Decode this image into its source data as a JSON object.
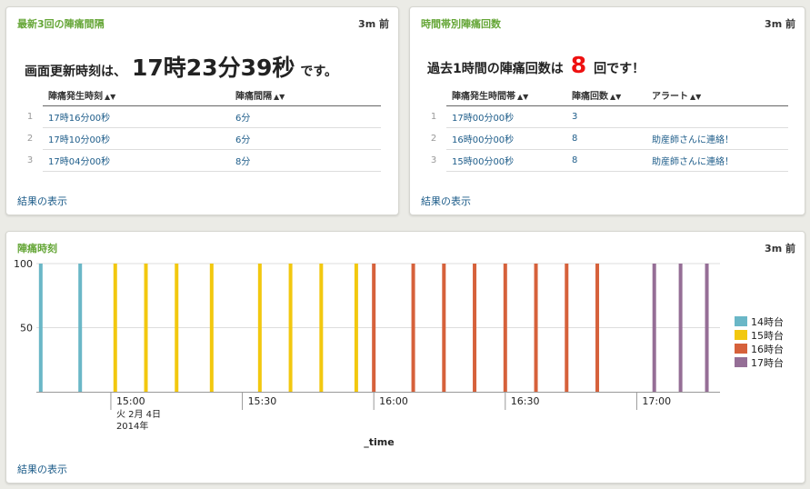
{
  "panel1": {
    "title": "最新3回の陣痛間隔",
    "time": "3m 前",
    "headline_prefix": "画面更新時刻は、",
    "headline_value": "17時23分39秒",
    "headline_suffix": "です。",
    "columns": [
      "陣痛発生時刻",
      "陣痛間隔"
    ],
    "sort_icon": "sort-icon",
    "rows": [
      {
        "idx": "1",
        "c1": "17時16分00秒",
        "c2": "6分"
      },
      {
        "idx": "2",
        "c1": "17時10分00秒",
        "c2": "6分"
      },
      {
        "idx": "3",
        "c1": "17時04分00秒",
        "c2": "8分"
      }
    ],
    "footer": "結果の表示"
  },
  "panel2": {
    "title": "時間帯別陣痛回数",
    "time": "3m 前",
    "headline_prefix": "過去1時間の陣痛回数は",
    "headline_value": "8",
    "headline_suffix": "回です！",
    "columns": [
      "陣痛発生時間帯",
      "陣痛回数",
      "アラート"
    ],
    "rows": [
      {
        "idx": "1",
        "c1": "17時00分00秒",
        "c2": "3",
        "c3": ""
      },
      {
        "idx": "2",
        "c1": "16時00分00秒",
        "c2": "8",
        "c3": "助産師さんに連絡！"
      },
      {
        "idx": "3",
        "c1": "15時00分00秒",
        "c2": "8",
        "c3": "助産師さんに連絡！"
      }
    ],
    "footer": "結果の表示"
  },
  "panel3": {
    "title": "陣痛時刻",
    "time": "3m 前",
    "footer": "結果の表示"
  },
  "chart_data": {
    "type": "bar",
    "xlabel": "_time",
    "ylabel": "",
    "ylim": [
      0,
      100
    ],
    "yticks": [
      50,
      100
    ],
    "x_range": [
      "14:43",
      "17:19"
    ],
    "xticks": [
      {
        "t": "15:00",
        "label": "15:00",
        "sub": [
          "火 2月 4日",
          "2014年"
        ]
      },
      {
        "t": "15:30",
        "label": "15:30",
        "sub": []
      },
      {
        "t": "16:00",
        "label": "16:00",
        "sub": []
      },
      {
        "t": "16:30",
        "label": "16:30",
        "sub": []
      },
      {
        "t": "17:00",
        "label": "17:00",
        "sub": []
      }
    ],
    "legend_position": "right",
    "series": [
      {
        "name": "14時台",
        "color": "#6ab7c7",
        "times": [
          "14:44",
          "14:53"
        ],
        "values": [
          100,
          100
        ]
      },
      {
        "name": "15時台",
        "color": "#f2c80f",
        "times": [
          "15:01",
          "15:08",
          "15:15",
          "15:23",
          "15:34",
          "15:41",
          "15:48",
          "15:56"
        ],
        "values": [
          100,
          100,
          100,
          100,
          100,
          100,
          100,
          100
        ]
      },
      {
        "name": "16時台",
        "color": "#d6613b",
        "times": [
          "16:00",
          "16:09",
          "16:16",
          "16:23",
          "16:30",
          "16:37",
          "16:44",
          "16:51"
        ],
        "values": [
          100,
          100,
          100,
          100,
          100,
          100,
          100,
          100
        ]
      },
      {
        "name": "17時台",
        "color": "#956e96",
        "times": [
          "17:04",
          "17:10",
          "17:16"
        ],
        "values": [
          100,
          100,
          100
        ]
      }
    ]
  }
}
